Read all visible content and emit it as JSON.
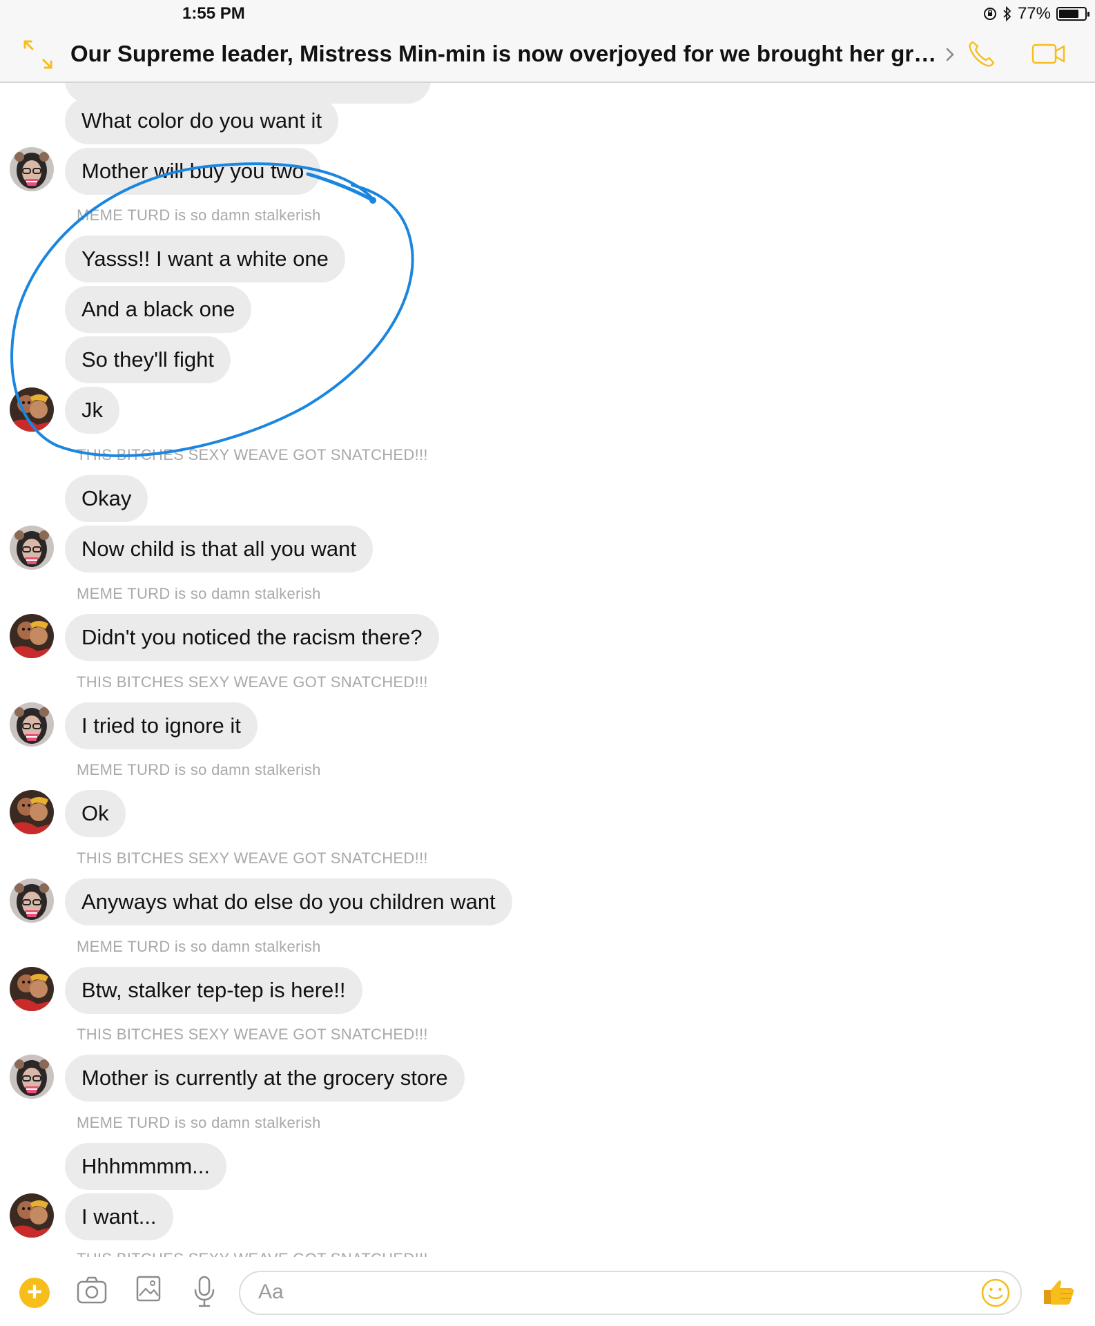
{
  "status_bar": {
    "time": "1:55 PM",
    "battery_text": "77%",
    "battery_level": 0.77
  },
  "header": {
    "title": "Our Supreme leader, Mistress Min-min is now overjoyed for we brought her gratific…",
    "accent_color": "#f7bd1b"
  },
  "messages": [
    {
      "text": "What color do you want it"
    },
    {
      "text": "Mother will buy you two"
    },
    {
      "caption": "MEME TURD is so damn stalkerish"
    },
    {
      "text": "Yasss!! I want a white one"
    },
    {
      "text": "And a black one"
    },
    {
      "text": "So they'll fight"
    },
    {
      "text": "Jk"
    },
    {
      "caption": "THIS BITCHES SEXY WEAVE GOT SNATCHED!!!"
    },
    {
      "text": "Okay"
    },
    {
      "text": "Now child is that all you want"
    },
    {
      "caption": "MEME TURD is so damn stalkerish"
    },
    {
      "text": "Didn't you noticed the racism there?"
    },
    {
      "caption": "THIS BITCHES SEXY WEAVE GOT SNATCHED!!!"
    },
    {
      "text": "I tried to ignore it"
    },
    {
      "caption": "MEME TURD is so damn stalkerish"
    },
    {
      "text": "Ok"
    },
    {
      "caption": "THIS BITCHES SEXY WEAVE GOT SNATCHED!!!"
    },
    {
      "text": "Anyways what do else do you children want"
    },
    {
      "caption": "MEME TURD is so damn stalkerish"
    },
    {
      "text": "Btw, stalker tep-tep is here!!"
    },
    {
      "caption": "THIS BITCHES SEXY WEAVE GOT SNATCHED!!!"
    },
    {
      "text": "Mother is currently at the grocery store"
    },
    {
      "caption": "MEME TURD is so damn stalkerish"
    },
    {
      "text": "Hhhmmmm..."
    },
    {
      "text": "I want..."
    },
    {
      "caption": "THIS BITCHES SEXY WEAVE GOT SNATCHED!!!"
    }
  ],
  "composer": {
    "placeholder": "Aa",
    "plus_label": "+"
  },
  "icons": [
    "expand-icon",
    "chevron-right-icon",
    "phone-icon",
    "video-icon",
    "camera-icon",
    "image-icon",
    "mic-icon",
    "emoji-icon",
    "thumbs-up-icon"
  ],
  "annotation_color": "#1a86e0"
}
